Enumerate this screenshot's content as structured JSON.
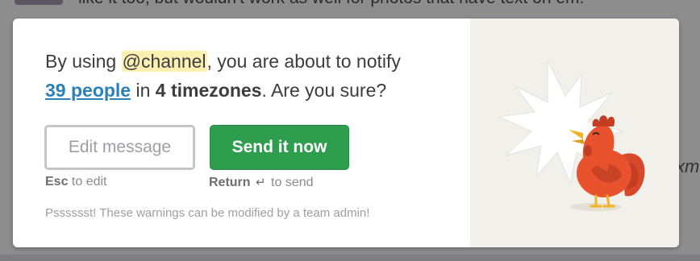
{
  "background": {
    "chat_text": "like it too, but wouldn't work as well for photos that have text on em.",
    "side_text": "xm"
  },
  "dialog": {
    "message": {
      "prefix": "By using ",
      "mention": "@channel",
      "middle": ", you are about to notify",
      "people_link": "39 people",
      "in_word": " in ",
      "timezones": "4 timezones",
      "suffix": ". Are you sure?"
    },
    "buttons": {
      "edit_label": "Edit message",
      "send_label": "Send it now"
    },
    "hints": {
      "edit_key": "Esc",
      "edit_text": " to edit",
      "send_key": "Return",
      "send_symbol": "↵",
      "send_text": " to send"
    },
    "note": "Psssssst! These warnings can be modified by a team admin!",
    "illustration": "rooster-crowing-icon"
  },
  "colors": {
    "send_button": "#2e9e4e",
    "link": "#2a80b9",
    "mention_highlight": "#fdefb0",
    "rooster": "#e8532e"
  }
}
